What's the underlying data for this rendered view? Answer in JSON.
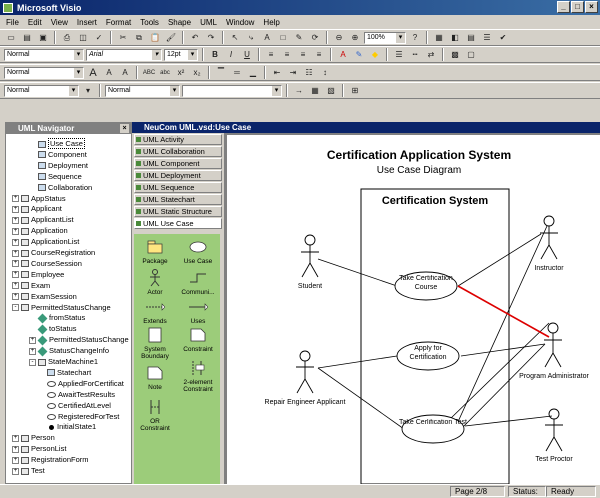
{
  "window": {
    "title": "Microsoft Visio"
  },
  "menu": [
    "File",
    "Edit",
    "View",
    "Insert",
    "Format",
    "Tools",
    "Shape",
    "UML",
    "Window",
    "Help"
  ],
  "toolbar1": {
    "zoom": "100%"
  },
  "toolbar2": {
    "style": "Normal",
    "font": "Arial",
    "size": "12pt",
    "bold": "B",
    "italic": "I",
    "underline": "U"
  },
  "toolbar3": {
    "style": "Normal",
    "abc1": "ABC",
    "abc2": "abc",
    "x2": "x²",
    "x_2": "x₂"
  },
  "toolbar4": {
    "line_style": "Normal",
    "fill_style": "Normal"
  },
  "navigator": {
    "title": "UML Navigator",
    "items": [
      {
        "label": "Use Case",
        "indent": 1,
        "icon": "usecase"
      },
      {
        "label": "Component",
        "indent": 1,
        "icon": "usecase"
      },
      {
        "label": "Deployment",
        "indent": 1,
        "icon": "usecase"
      },
      {
        "label": "Sequence",
        "indent": 1,
        "icon": "usecase"
      },
      {
        "label": "Collaboration",
        "indent": 1,
        "icon": "usecase"
      },
      {
        "label": "AppStatus",
        "indent": 0,
        "icon": "class",
        "exp": "+"
      },
      {
        "label": "Applicant",
        "indent": 0,
        "icon": "class",
        "exp": "+"
      },
      {
        "label": "ApplicantList",
        "indent": 0,
        "icon": "class",
        "exp": "+"
      },
      {
        "label": "Application",
        "indent": 0,
        "icon": "class",
        "exp": "+"
      },
      {
        "label": "ApplicationList",
        "indent": 0,
        "icon": "class",
        "exp": "+"
      },
      {
        "label": "CourseRegistration",
        "indent": 0,
        "icon": "class",
        "exp": "+"
      },
      {
        "label": "CourseSession",
        "indent": 0,
        "icon": "class",
        "exp": "+"
      },
      {
        "label": "Employee",
        "indent": 0,
        "icon": "class",
        "exp": "+"
      },
      {
        "label": "Exam",
        "indent": 0,
        "icon": "class",
        "exp": "+"
      },
      {
        "label": "ExamSession",
        "indent": 0,
        "icon": "class",
        "exp": "+"
      },
      {
        "label": "PermittedStatusChange",
        "indent": 0,
        "icon": "class",
        "exp": "-"
      },
      {
        "label": "fromStatus",
        "indent": 1,
        "icon": "assoc"
      },
      {
        "label": "toStatus",
        "indent": 1,
        "icon": "assoc"
      },
      {
        "label": "PermittedStatusChange",
        "indent": 1,
        "icon": "assoc",
        "exp": "+"
      },
      {
        "label": "StatusChangeInfo",
        "indent": 1,
        "icon": "assoc",
        "exp": "+"
      },
      {
        "label": "StateMachine1",
        "indent": 1,
        "icon": "state",
        "exp": "-"
      },
      {
        "label": "Statechart",
        "indent": 2,
        "icon": "usecase"
      },
      {
        "label": "AppliedForCertificat",
        "indent": 2,
        "icon": "oval"
      },
      {
        "label": "AwaitTestResults",
        "indent": 2,
        "icon": "oval"
      },
      {
        "label": "CertifiedAtLevel",
        "indent": 2,
        "icon": "oval"
      },
      {
        "label": "RegisteredForTest",
        "indent": 2,
        "icon": "oval"
      },
      {
        "label": "InitialState1",
        "indent": 2,
        "icon": "dot"
      },
      {
        "label": "Person",
        "indent": 0,
        "icon": "class",
        "exp": "+"
      },
      {
        "label": "PersonList",
        "indent": 0,
        "icon": "class",
        "exp": "+"
      },
      {
        "label": "RegistrationForm",
        "indent": 0,
        "icon": "class",
        "exp": "+"
      },
      {
        "label": "Test",
        "indent": 0,
        "icon": "class",
        "exp": "+"
      }
    ]
  },
  "document": {
    "title": "NeuCom UML.vsd:Use Case"
  },
  "stencil": {
    "tabs": [
      "UML Activity",
      "UML Collaboration",
      "UML Component",
      "UML Deployment",
      "UML Sequence",
      "UML Statechart",
      "UML Static Structure",
      "UML Use Case"
    ],
    "shapes": [
      "Package",
      "Use Case",
      "Actor",
      "Communi...",
      "Extends",
      "Uses",
      "System Boundary",
      "Constraint",
      "Note",
      "2-element Constraint",
      "OR Constraint"
    ]
  },
  "diagram": {
    "title": "Certification Application System",
    "subtitle": "Use Case Diagram",
    "boundary": "Certification System",
    "usecases": [
      "Take Certification Course",
      "Apply for Certification",
      "Take Cerlification Test"
    ],
    "actors": [
      "Student",
      "Instructor",
      "Repair Engineer Applicant",
      "Program Administrator",
      "Test Proctor"
    ]
  },
  "status": {
    "page": "Page 2/8",
    "status_label": "Status:",
    "status_value": "Ready"
  }
}
